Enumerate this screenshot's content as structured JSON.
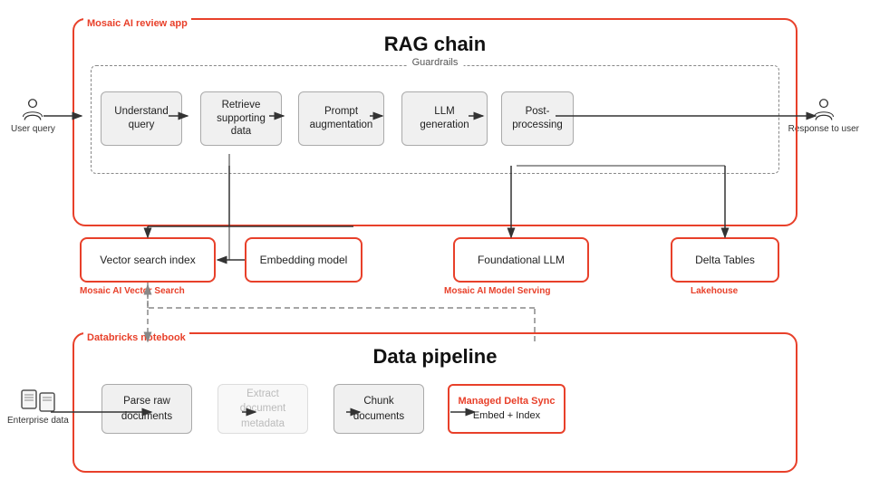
{
  "rag": {
    "app_label": "Mosaic AI review app",
    "title": "RAG chain",
    "guardrails_label": "Guardrails",
    "steps": [
      {
        "id": "understand",
        "label": "Understand\nquery"
      },
      {
        "id": "retrieve",
        "label": "Retrieve\nsupporting\ndata"
      },
      {
        "id": "prompt",
        "label": "Prompt\naugmentation"
      },
      {
        "id": "llm",
        "label": "LLM\ngeneration"
      },
      {
        "id": "post",
        "label": "Post-\nprocessing"
      }
    ]
  },
  "middle": {
    "vector_search": {
      "label": "Vector search index",
      "sublabel": "Mosaic AI Vector Search"
    },
    "embedding": {
      "label": "Embedding model"
    },
    "foundational": {
      "label": "Foundational LLM",
      "sublabel": "Mosaic AI Model Serving"
    },
    "delta": {
      "label": "Delta Tables",
      "sublabel": "Lakehouse"
    }
  },
  "data_pipeline": {
    "notebook_label": "Databricks notebook",
    "title": "Data pipeline",
    "steps": [
      {
        "id": "parse",
        "label": "Parse raw\ndocuments"
      },
      {
        "id": "extract",
        "label": "Extract\ndocument\nmetadata",
        "grayed": true
      },
      {
        "id": "chunk",
        "label": "Chunk\ndocuments"
      },
      {
        "id": "managed",
        "label": "Managed Delta Sync\nEmbed + Index",
        "highlight": true
      }
    ]
  },
  "user_query": "User\nquery",
  "response": "Response\nto user",
  "enterprise": "Enterprise\ndata"
}
